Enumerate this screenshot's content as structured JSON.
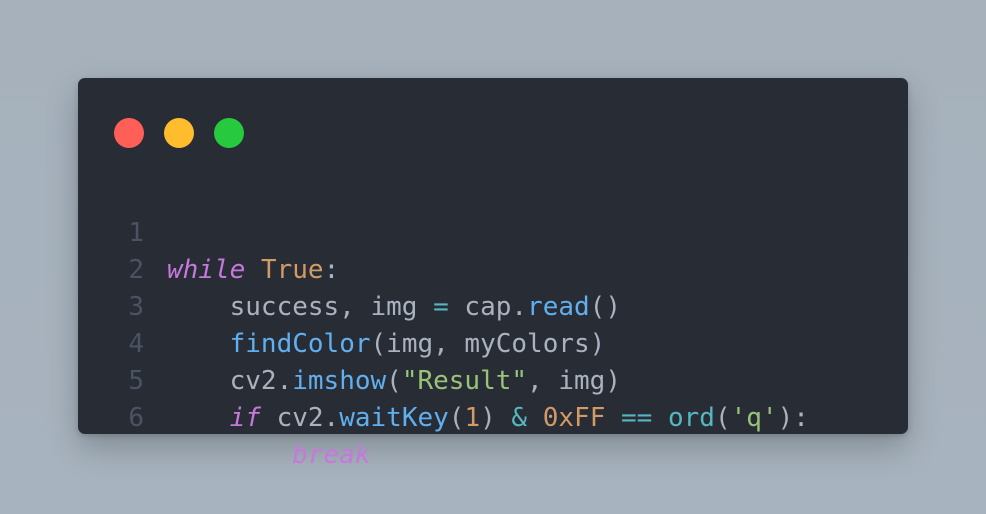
{
  "window": {
    "buttons": [
      {
        "name": "close",
        "color": "#ff5f56"
      },
      {
        "name": "minimize",
        "color": "#ffbd2e"
      },
      {
        "name": "maximize",
        "color": "#27c93f"
      }
    ]
  },
  "code": {
    "line_numbers": [
      "1",
      "2",
      "3",
      "4",
      "5",
      "6"
    ],
    "lines": [
      [
        {
          "t": "while",
          "k": "kw"
        },
        {
          "t": " ",
          "k": "plain"
        },
        {
          "t": "True",
          "k": "const"
        },
        {
          "t": ":",
          "k": "plain"
        }
      ],
      [
        {
          "t": "    success, img ",
          "k": "plain"
        },
        {
          "t": "=",
          "k": "op"
        },
        {
          "t": " cap.",
          "k": "plain"
        },
        {
          "t": "read",
          "k": "fn"
        },
        {
          "t": "()",
          "k": "plain"
        }
      ],
      [
        {
          "t": "    ",
          "k": "plain"
        },
        {
          "t": "findColor",
          "k": "fn"
        },
        {
          "t": "(img, myColors)",
          "k": "plain"
        }
      ],
      [
        {
          "t": "    cv2.",
          "k": "plain"
        },
        {
          "t": "imshow",
          "k": "fn"
        },
        {
          "t": "(",
          "k": "plain"
        },
        {
          "t": "\"Result\"",
          "k": "str"
        },
        {
          "t": ", img)",
          "k": "plain"
        }
      ],
      [
        {
          "t": "    ",
          "k": "plain"
        },
        {
          "t": "if",
          "k": "kw"
        },
        {
          "t": " cv2.",
          "k": "plain"
        },
        {
          "t": "waitKey",
          "k": "fn"
        },
        {
          "t": "(",
          "k": "plain"
        },
        {
          "t": "1",
          "k": "num"
        },
        {
          "t": ") ",
          "k": "plain"
        },
        {
          "t": "&",
          "k": "op"
        },
        {
          "t": " ",
          "k": "plain"
        },
        {
          "t": "0xFF",
          "k": "num"
        },
        {
          "t": " ",
          "k": "plain"
        },
        {
          "t": "==",
          "k": "op"
        },
        {
          "t": " ",
          "k": "plain"
        },
        {
          "t": "ord",
          "k": "builtin"
        },
        {
          "t": "(",
          "k": "plain"
        },
        {
          "t": "'q'",
          "k": "str"
        },
        {
          "t": "):",
          "k": "plain"
        }
      ],
      [
        {
          "t": "        ",
          "k": "plain"
        },
        {
          "t": "break",
          "k": "kw"
        }
      ]
    ]
  }
}
